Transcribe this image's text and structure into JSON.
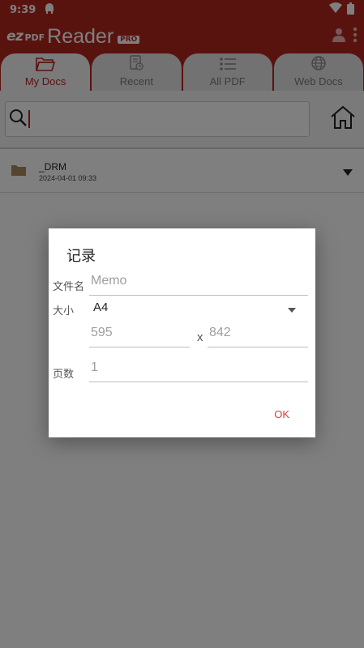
{
  "status_bar": {
    "time": "9:39"
  },
  "app": {
    "logo_ez": "ez",
    "logo_pdf": "PDF",
    "logo_reader": "Reader",
    "logo_pro": "PRO"
  },
  "tabs": [
    {
      "label": "My Docs",
      "icon": "folder-open-icon",
      "active": true
    },
    {
      "label": "Recent",
      "icon": "recent-doc-icon",
      "active": false
    },
    {
      "label": "All PDF",
      "icon": "list-icon",
      "active": false
    },
    {
      "label": "Web Docs",
      "icon": "globe-icon",
      "active": false
    }
  ],
  "search": {
    "value": ""
  },
  "files": [
    {
      "name": "_DRM",
      "date": "2024-04-01 09:33"
    }
  ],
  "dialog": {
    "title": "记录",
    "filename_label": "文件名",
    "filename_placeholder": "Memo",
    "size_label": "大小",
    "size_value": "A4",
    "width_placeholder": "595",
    "x_separator": "x",
    "height_placeholder": "842",
    "pages_label": "页数",
    "pages_placeholder": "1",
    "ok_label": "OK"
  },
  "colors": {
    "brand": "#b3261e",
    "accent": "#e53935",
    "folder": "#a88a58"
  }
}
